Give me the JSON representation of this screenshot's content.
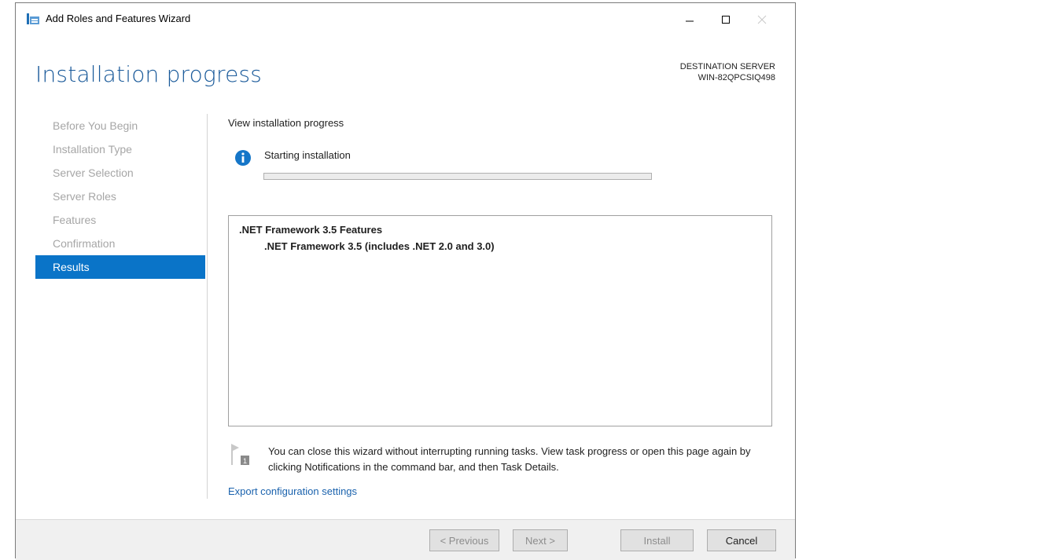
{
  "window": {
    "title": "Add Roles and Features Wizard"
  },
  "header": {
    "title": "Installation progress",
    "destination_label": "DESTINATION SERVER",
    "destination_server": "WIN-82QPCSIQ498"
  },
  "nav": {
    "items": [
      {
        "label": "Before You Begin",
        "active": false
      },
      {
        "label": "Installation Type",
        "active": false
      },
      {
        "label": "Server Selection",
        "active": false
      },
      {
        "label": "Server Roles",
        "active": false
      },
      {
        "label": "Features",
        "active": false
      },
      {
        "label": "Confirmation",
        "active": false
      },
      {
        "label": "Results",
        "active": true
      }
    ]
  },
  "main": {
    "section_title": "View installation progress",
    "status_text": "Starting installation",
    "progress_fraction": 0,
    "features": [
      {
        "label": ".NET Framework 3.5 Features",
        "level": 0
      },
      {
        "label": ".NET Framework 3.5 (includes .NET 2.0 and 3.0)",
        "level": 1
      }
    ],
    "notice_badge": "1",
    "notice_text": "You can close this wizard without interrupting running tasks. View task progress or open this page again by clicking Notifications in the command bar, and then Task Details.",
    "export_link": "Export configuration settings"
  },
  "footer": {
    "previous_label": "< Previous",
    "next_label": "Next >",
    "install_label": "Install",
    "cancel_label": "Cancel"
  },
  "colors": {
    "accent": "#0a74c8",
    "title_blue": "#1a5a9a",
    "link": "#1a62ad",
    "info": "#1576c8"
  },
  "icons": {
    "app": "server-manager-icon",
    "status": "info-icon",
    "notice": "flag-icon"
  }
}
